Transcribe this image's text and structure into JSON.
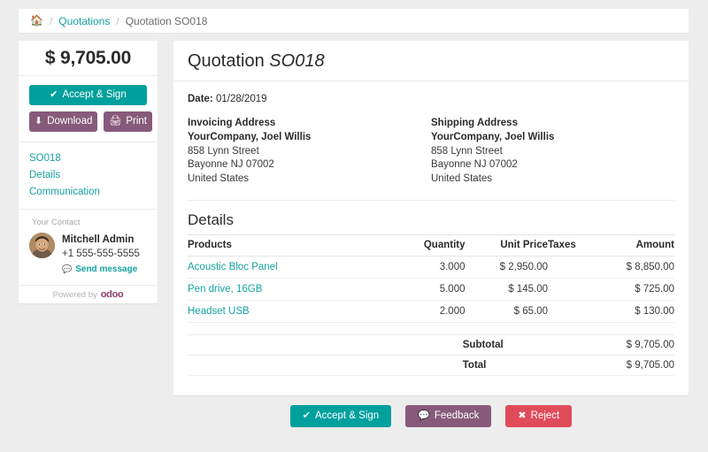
{
  "breadcrumb": {
    "home_icon": "home-icon",
    "separator": "/",
    "items": [
      {
        "label": "Quotations",
        "type": "link"
      },
      {
        "label": "Quotation SO018",
        "type": "current"
      }
    ]
  },
  "sidebar": {
    "amount": "$ 9,705.00",
    "accept_label": "Accept & Sign",
    "accept_icon": "check-icon",
    "download_label": "Download",
    "download_icon": "download-icon",
    "print_label": "Print",
    "print_icon": "printer-icon",
    "nav": [
      {
        "label": "SO018"
      },
      {
        "label": "Details"
      },
      {
        "label": "Communication"
      }
    ],
    "contact": {
      "title": "Your Contact",
      "name": "Mitchell Admin",
      "phone": "+1 555-555-5555",
      "send_message_label": "Send message",
      "send_message_icon": "comment-icon",
      "avatar_alt": "avatar"
    },
    "powered_by": "Powered by",
    "brand": "odoo"
  },
  "main": {
    "title_prefix": "Quotation ",
    "title_ref": "SO018",
    "date_label": "Date:",
    "date_value": "01/28/2019",
    "invoicing": {
      "title": "Invoicing Address",
      "company": "YourCompany, Joel Willis",
      "lines": [
        "858 Lynn Street",
        "Bayonne NJ 07002",
        "United States"
      ]
    },
    "shipping": {
      "title": "Shipping Address",
      "company": "YourCompany, Joel Willis",
      "lines": [
        "858 Lynn Street",
        "Bayonne NJ 07002",
        "United States"
      ]
    },
    "details_heading": "Details",
    "table": {
      "columns": [
        "Products",
        "Quantity",
        "Unit Price",
        "Taxes",
        "Amount"
      ],
      "rows": [
        {
          "product": "Acoustic Bloc Panel",
          "quantity": "3.000",
          "unit_price": "$ 2,950.00",
          "taxes": "",
          "amount": "$ 8,850.00"
        },
        {
          "product": "Pen drive, 16GB",
          "quantity": "5.000",
          "unit_price": "$ 145.00",
          "taxes": "",
          "amount": "$ 725.00"
        },
        {
          "product": "Headset USB",
          "quantity": "2.000",
          "unit_price": "$ 65.00",
          "taxes": "",
          "amount": "$ 130.00"
        }
      ]
    },
    "totals": [
      {
        "label": "Subtotal",
        "value": "$ 9,705.00"
      },
      {
        "label": "Total",
        "value": "$ 9,705.00"
      }
    ]
  },
  "footer": {
    "accept_label": "Accept & Sign",
    "accept_icon": "check-icon",
    "feedback_label": "Feedback",
    "feedback_icon": "comment-icon",
    "reject_label": "Reject",
    "reject_icon": "times-icon"
  },
  "colors": {
    "teal": "#00a09d",
    "link_teal": "#17a2a2",
    "purple": "#875a7b",
    "red": "#e04b5a",
    "page_bg": "#ededed",
    "card_bg": "#ffffff"
  }
}
